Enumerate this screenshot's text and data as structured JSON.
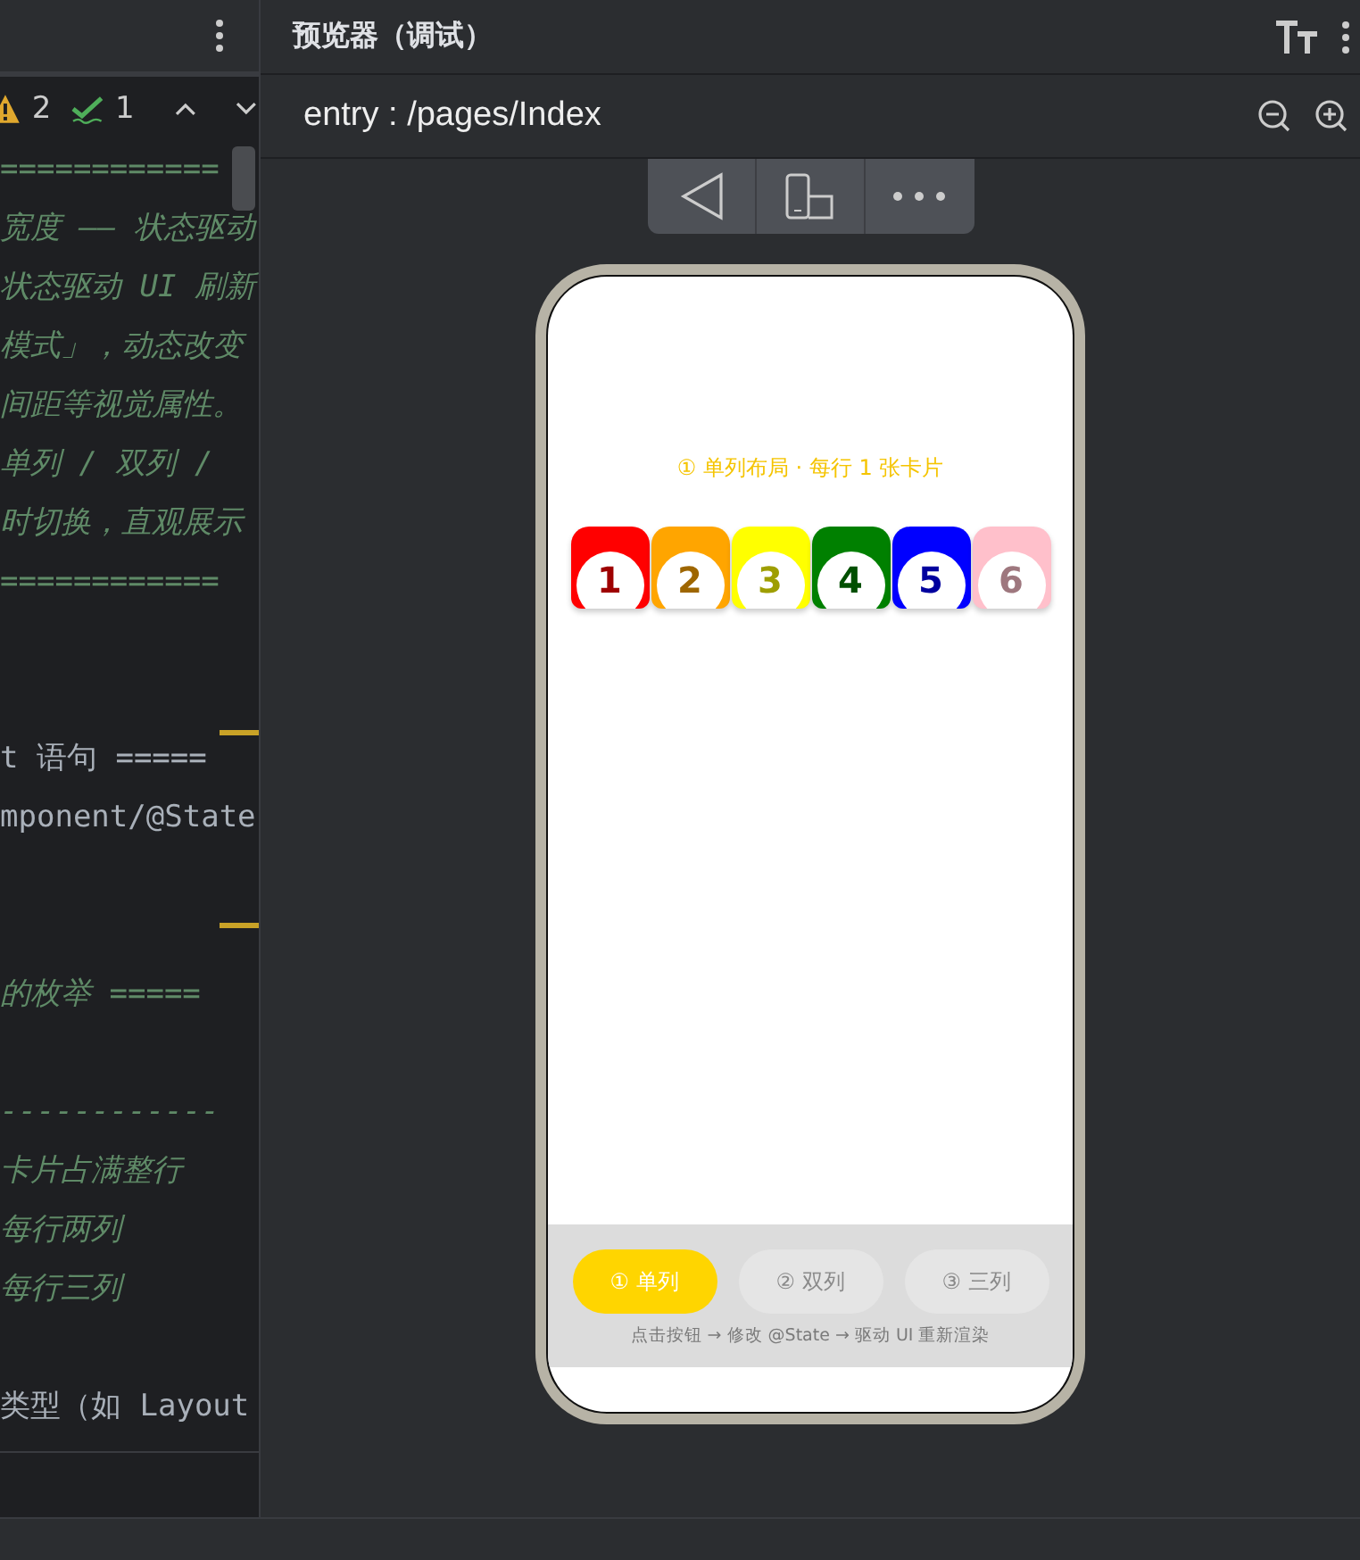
{
  "editor": {
    "problems": {
      "warnings": "2",
      "checks": "1"
    },
    "lines": [
      {
        "kind": "comment",
        "text": "============"
      },
      {
        "kind": "comment",
        "text": "宽度 —— 状态驱动"
      },
      {
        "kind": "comment",
        "text": "状态驱动 UI 刷新"
      },
      {
        "kind": "comment",
        "text": "模式」，动态改变"
      },
      {
        "kind": "comment",
        "text": "间距等视觉属性。"
      },
      {
        "kind": "comment",
        "text": "单列 / 双列 / "
      },
      {
        "kind": "comment",
        "text": "时切换，直观展示"
      },
      {
        "kind": "comment",
        "text": "============"
      },
      {
        "kind": "blank"
      },
      {
        "kind": "blank"
      },
      {
        "kind": "code",
        "text": "t 语句 ====="
      },
      {
        "kind": "code",
        "text": "mponent/@State"
      },
      {
        "kind": "blank"
      },
      {
        "kind": "blank"
      },
      {
        "kind": "comment",
        "text": "的枚举 ====="
      },
      {
        "kind": "blank"
      },
      {
        "kind": "comment",
        "text": "------------"
      },
      {
        "kind": "comment",
        "text": "卡片占满整行"
      },
      {
        "kind": "comment",
        "text": "每行两列"
      },
      {
        "kind": "comment",
        "text": "每行三列"
      },
      {
        "kind": "blank"
      },
      {
        "kind": "code",
        "text": "类型（如 Layout"
      }
    ]
  },
  "preview": {
    "title": "预览器（调试）",
    "route": "entry : /pages/Index",
    "screen": {
      "heading": "① 单列布局 · 每行 1 张卡片",
      "cards": [
        {
          "label": "1",
          "color": "#ff0000"
        },
        {
          "label": "2",
          "color": "#ffa500"
        },
        {
          "label": "3",
          "color": "#ffff00"
        },
        {
          "label": "4",
          "color": "#008000"
        },
        {
          "label": "5",
          "color": "#0000ff"
        },
        {
          "label": "6",
          "color": "#ffc0cb"
        }
      ],
      "buttons": [
        {
          "label": "① 单列",
          "selected": true
        },
        {
          "label": "② 双列",
          "selected": false
        },
        {
          "label": "③ 三列",
          "selected": false
        }
      ],
      "hint": "点击按钮 → 修改 @State → 驱动 UI 重新渲染"
    }
  }
}
